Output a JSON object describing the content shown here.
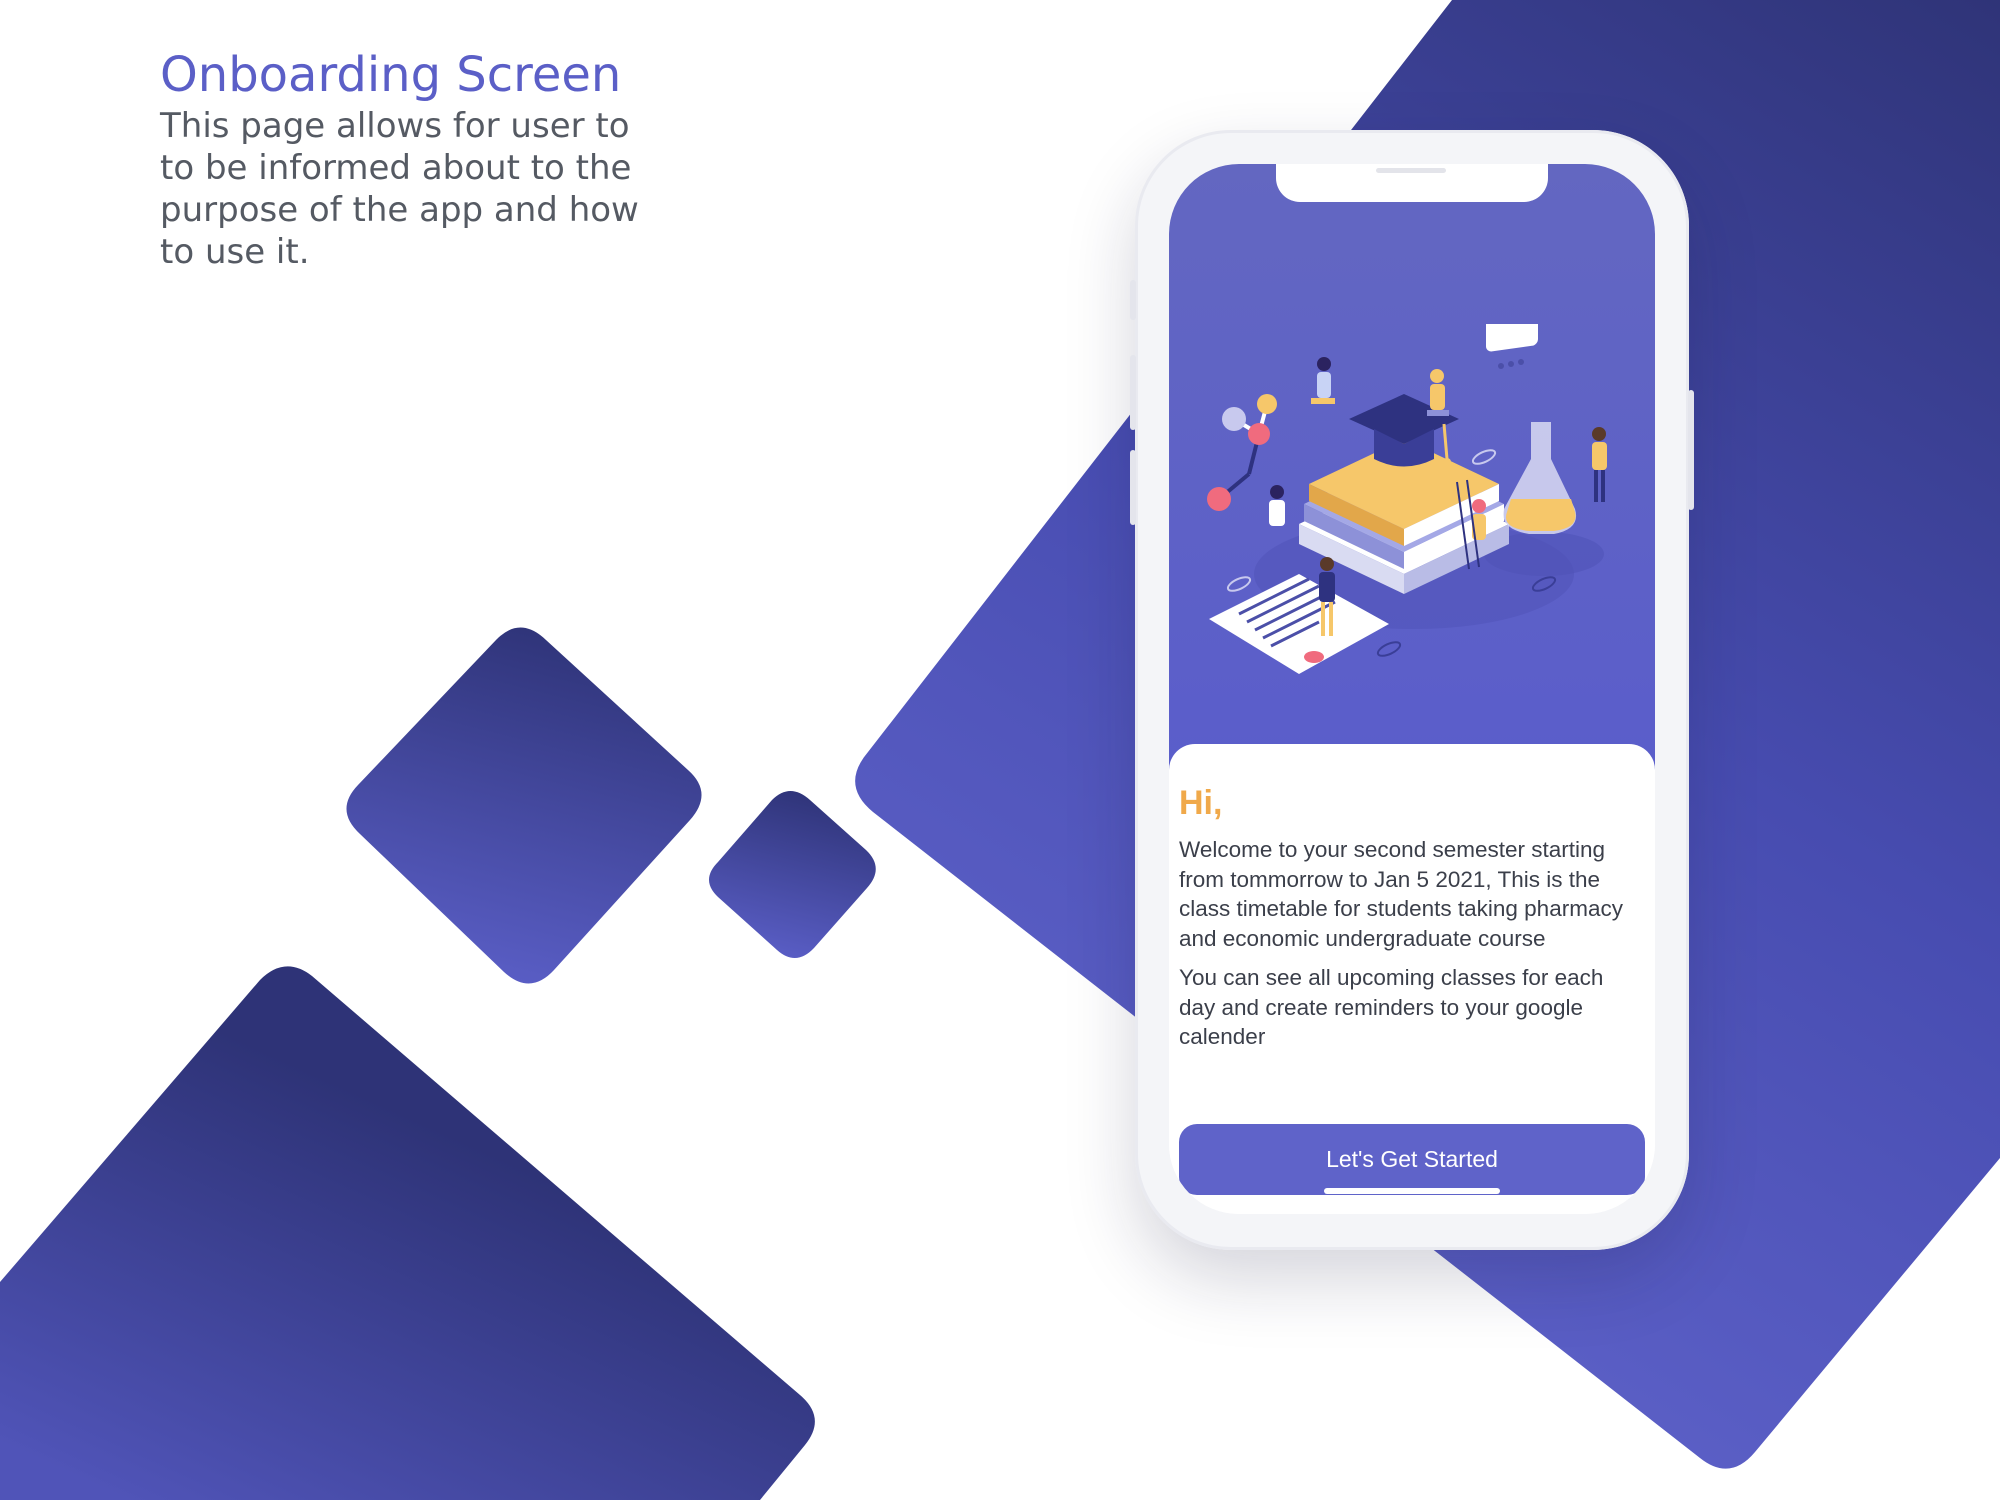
{
  "caption": {
    "title": "Onboarding Screen",
    "description": "This page allows for user to to be informed about to the purpose of the app and how to use it."
  },
  "onboarding": {
    "greeting": "Hi,",
    "paragraph_1": "Welcome to your second semester starting from tommorrow to Jan 5 2021, This is the class timetable for students taking pharmacy and economic undergraduate course",
    "paragraph_2": "You can see all upcoming classes for each day and create reminders to your google calender",
    "cta_label": "Let's Get Started",
    "illustration": "education-isometric-illustration"
  },
  "colors": {
    "accent": "#5f63c9",
    "hero_background": "#5a5dcb",
    "greeting": "#f0a94a",
    "shape_dark": "#2e3377",
    "shape_light": "#5c60c7",
    "caption_title": "#5b5fc7",
    "body_text": "#3b3f4a"
  }
}
